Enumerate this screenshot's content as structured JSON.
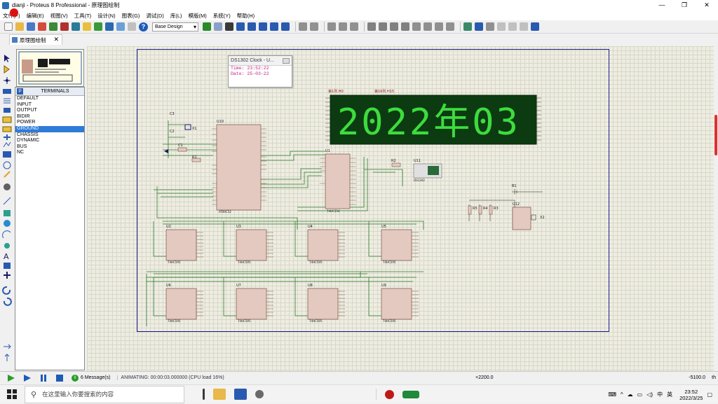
{
  "window": {
    "title": "dianji - Proteus 8 Professional - 原理图绘制",
    "controls": [
      "—",
      "❐",
      "✕"
    ]
  },
  "menu": [
    "文件(F)",
    "编辑(E)",
    "视图(V)",
    "工具(T)",
    "设计(N)",
    "图表(G)",
    "调试(D)",
    "库(L)",
    "模版(M)",
    "系统(Y)",
    "帮助(H)"
  ],
  "toolbar": {
    "help_label": "?",
    "design_combo": "Base Design"
  },
  "tab": {
    "label": "原理图绘制",
    "close": "✕"
  },
  "terminals": {
    "header_label": "P",
    "title": "TERMINALS",
    "items": [
      "DEFAULT",
      "INPUT",
      "OUTPUT",
      "BIDIR",
      "POWER",
      "GROUND",
      "CHASSIS",
      "DYNAMIC",
      "BUS",
      "NC"
    ],
    "selected": "GROUND"
  },
  "clock_popup": {
    "title": "DS1302 Clock - U...",
    "time_line": "Time: 23:52:22",
    "date_line": "Date: 25-03-22"
  },
  "dot_matrix": {
    "left_label": "第1列 H0",
    "right_label": "第16列 H15",
    "display_text": "2022年03",
    "led_color": "#3ddc3d"
  },
  "components": {
    "u10": "U10",
    "u1": "U1",
    "u11": "U11",
    "u12": "U12",
    "b1": "B1",
    "x1": "X1",
    "x2": "X2",
    "r1": "R1",
    "r2": "R2",
    "r3": "R3",
    "r4": "R4",
    "r5": "R5",
    "c1": "C1",
    "c2": "C2",
    "c3": "C3",
    "u10_part": "AT89C52",
    "u1_part": "74HC154",
    "u11_part": "DS1302",
    "drivers": [
      "U2",
      "U3",
      "U4",
      "U5",
      "U6",
      "U7",
      "U8",
      "U9"
    ],
    "driver_part": "74HC595"
  },
  "status": {
    "messages": "6 Message(s)",
    "animating": "ANIMATING: 00:00:03.000000 (CPU load 16%)",
    "x_coord": "+2200.0",
    "y_coord": "-5100.0",
    "unit": "th"
  },
  "taskbar": {
    "search_placeholder": "在这里输入你要搜索的内容",
    "time": "23:52",
    "date": "2022/3/25",
    "ime": "中",
    "ime2": "英"
  },
  "colors": {
    "canvas_bg": "#eeede2",
    "sheet_border": "#1a1a8a",
    "chip_fill": "#e4c9c0",
    "matrix_bg": "#0c3b12",
    "wire": "#2e7d2e",
    "recording_dot": "#e01010"
  }
}
